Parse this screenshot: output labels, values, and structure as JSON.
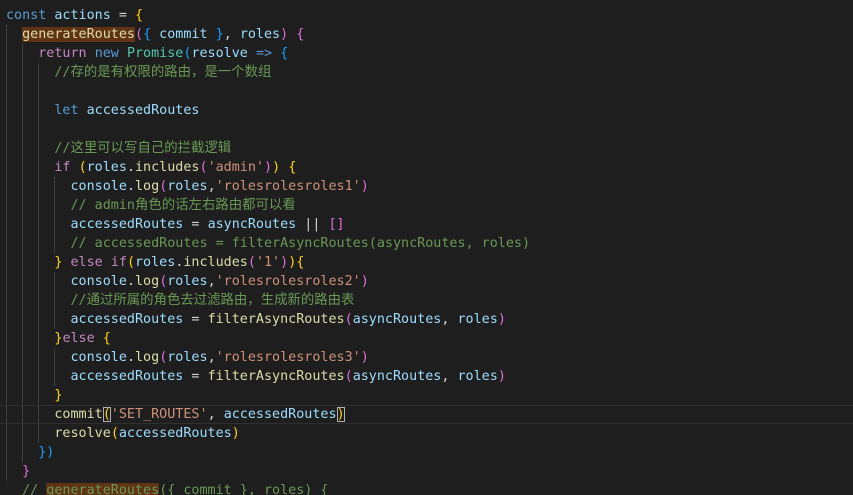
{
  "lines": [
    [
      [
        "kw",
        "const "
      ],
      [
        "var",
        "actions"
      ],
      [
        "txt",
        " = "
      ],
      [
        "b1",
        "{"
      ]
    ],
    [
      [
        "txt",
        "  "
      ],
      [
        "fn hl",
        "generateRoutes"
      ],
      [
        "b2",
        "("
      ],
      [
        "b3",
        "{"
      ],
      [
        "var",
        " commit "
      ],
      [
        "b3",
        "}"
      ],
      [
        "txt",
        ", "
      ],
      [
        "var",
        "roles"
      ],
      [
        "b2",
        ")"
      ],
      [
        "txt",
        " "
      ],
      [
        "b2",
        "{"
      ]
    ],
    [
      [
        "txt",
        "    "
      ],
      [
        "ctl",
        "return "
      ],
      [
        "kw",
        "new "
      ],
      [
        "cls",
        "Promise"
      ],
      [
        "b3",
        "("
      ],
      [
        "var",
        "resolve"
      ],
      [
        "txt",
        " "
      ],
      [
        "kw",
        "=>"
      ],
      [
        "txt",
        " "
      ],
      [
        "b3",
        "{"
      ]
    ],
    [
      [
        "txt",
        "      "
      ],
      [
        "com",
        "//存的是有权限的路由，是一个数组"
      ]
    ],
    [
      [
        "txt",
        ""
      ]
    ],
    [
      [
        "txt",
        "      "
      ],
      [
        "kw",
        "let "
      ],
      [
        "var",
        "accessedRoutes"
      ]
    ],
    [
      [
        "txt",
        ""
      ]
    ],
    [
      [
        "txt",
        "      "
      ],
      [
        "com",
        "//这里可以写自己的拦截逻辑"
      ]
    ],
    [
      [
        "txt",
        "      "
      ],
      [
        "ctl",
        "if "
      ],
      [
        "b1",
        "("
      ],
      [
        "var",
        "roles"
      ],
      [
        "txt",
        "."
      ],
      [
        "fn",
        "includes"
      ],
      [
        "b2",
        "("
      ],
      [
        "str",
        "'admin'"
      ],
      [
        "b2",
        ")"
      ],
      [
        "b1",
        ")"
      ],
      [
        "txt",
        " "
      ],
      [
        "b1",
        "{"
      ]
    ],
    [
      [
        "txt",
        "        "
      ],
      [
        "var",
        "console"
      ],
      [
        "txt",
        "."
      ],
      [
        "fn",
        "log"
      ],
      [
        "b2",
        "("
      ],
      [
        "var",
        "roles"
      ],
      [
        "txt",
        ","
      ],
      [
        "str",
        "'rolesrolesroles1'"
      ],
      [
        "b2",
        ")"
      ]
    ],
    [
      [
        "txt",
        "        "
      ],
      [
        "com",
        "// admin角色的话左右路由都可以看"
      ]
    ],
    [
      [
        "txt",
        "        "
      ],
      [
        "var",
        "accessedRoutes"
      ],
      [
        "txt",
        " = "
      ],
      [
        "var",
        "asyncRoutes"
      ],
      [
        "txt",
        " || "
      ],
      [
        "b2",
        "[]"
      ]
    ],
    [
      [
        "txt",
        "        "
      ],
      [
        "com",
        "// accessedRoutes = filterAsyncRoutes(asyncRoutes, roles)"
      ]
    ],
    [
      [
        "txt",
        "      "
      ],
      [
        "b1",
        "}"
      ],
      [
        "ctl",
        " else "
      ],
      [
        "ctl",
        "if"
      ],
      [
        "b1",
        "("
      ],
      [
        "var",
        "roles"
      ],
      [
        "txt",
        "."
      ],
      [
        "fn",
        "includes"
      ],
      [
        "b2",
        "("
      ],
      [
        "str",
        "'1'"
      ],
      [
        "b2",
        ")"
      ],
      [
        "b1",
        ")"
      ],
      [
        "b1",
        "{"
      ]
    ],
    [
      [
        "txt",
        "        "
      ],
      [
        "var",
        "console"
      ],
      [
        "txt",
        "."
      ],
      [
        "fn",
        "log"
      ],
      [
        "b2",
        "("
      ],
      [
        "var",
        "roles"
      ],
      [
        "txt",
        ","
      ],
      [
        "str",
        "'rolesrolesroles2'"
      ],
      [
        "b2",
        ")"
      ]
    ],
    [
      [
        "txt",
        "        "
      ],
      [
        "com",
        "//通过所属的角色去过滤路由，生成新的路由表"
      ]
    ],
    [
      [
        "txt",
        "        "
      ],
      [
        "var",
        "accessedRoutes"
      ],
      [
        "txt",
        " = "
      ],
      [
        "fn",
        "filterAsyncRoutes"
      ],
      [
        "b2",
        "("
      ],
      [
        "var",
        "asyncRoutes"
      ],
      [
        "txt",
        ", "
      ],
      [
        "var",
        "roles"
      ],
      [
        "b2",
        ")"
      ]
    ],
    [
      [
        "txt",
        "      "
      ],
      [
        "b1",
        "}"
      ],
      [
        "ctl",
        "else"
      ],
      [
        "txt",
        " "
      ],
      [
        "b1",
        "{"
      ]
    ],
    [
      [
        "txt",
        "        "
      ],
      [
        "var",
        "console"
      ],
      [
        "txt",
        "."
      ],
      [
        "fn",
        "log"
      ],
      [
        "b2",
        "("
      ],
      [
        "var",
        "roles"
      ],
      [
        "txt",
        ","
      ],
      [
        "str",
        "'rolesrolesroles3'"
      ],
      [
        "b2",
        ")"
      ]
    ],
    [
      [
        "txt",
        "        "
      ],
      [
        "var",
        "accessedRoutes"
      ],
      [
        "txt",
        " = "
      ],
      [
        "fn",
        "filterAsyncRoutes"
      ],
      [
        "b2",
        "("
      ],
      [
        "var",
        "asyncRoutes"
      ],
      [
        "txt",
        ", "
      ],
      [
        "var",
        "roles"
      ],
      [
        "b2",
        ")"
      ]
    ],
    [
      [
        "txt",
        "      "
      ],
      [
        "b1",
        "}"
      ]
    ],
    [
      [
        "txt",
        "      "
      ],
      [
        "fn",
        "commit"
      ],
      [
        "b1 bm",
        "("
      ],
      [
        "str",
        "'SET_ROUTES'"
      ],
      [
        "txt",
        ", "
      ],
      [
        "var",
        "accessedRoutes"
      ],
      [
        "b1 bm",
        ")"
      ]
    ],
    [
      [
        "txt",
        "      "
      ],
      [
        "fn",
        "resolve"
      ],
      [
        "b1",
        "("
      ],
      [
        "var",
        "accessedRoutes"
      ],
      [
        "b1",
        ")"
      ]
    ],
    [
      [
        "txt",
        "    "
      ],
      [
        "b3",
        "})"
      ]
    ],
    [
      [
        "txt",
        "  "
      ],
      [
        "b2",
        "}"
      ]
    ],
    [
      [
        "txt",
        "  "
      ],
      [
        "com",
        "// "
      ],
      [
        "com hl",
        "generateRoutes"
      ],
      [
        "com",
        "({ commit }, roles) {"
      ]
    ]
  ]
}
